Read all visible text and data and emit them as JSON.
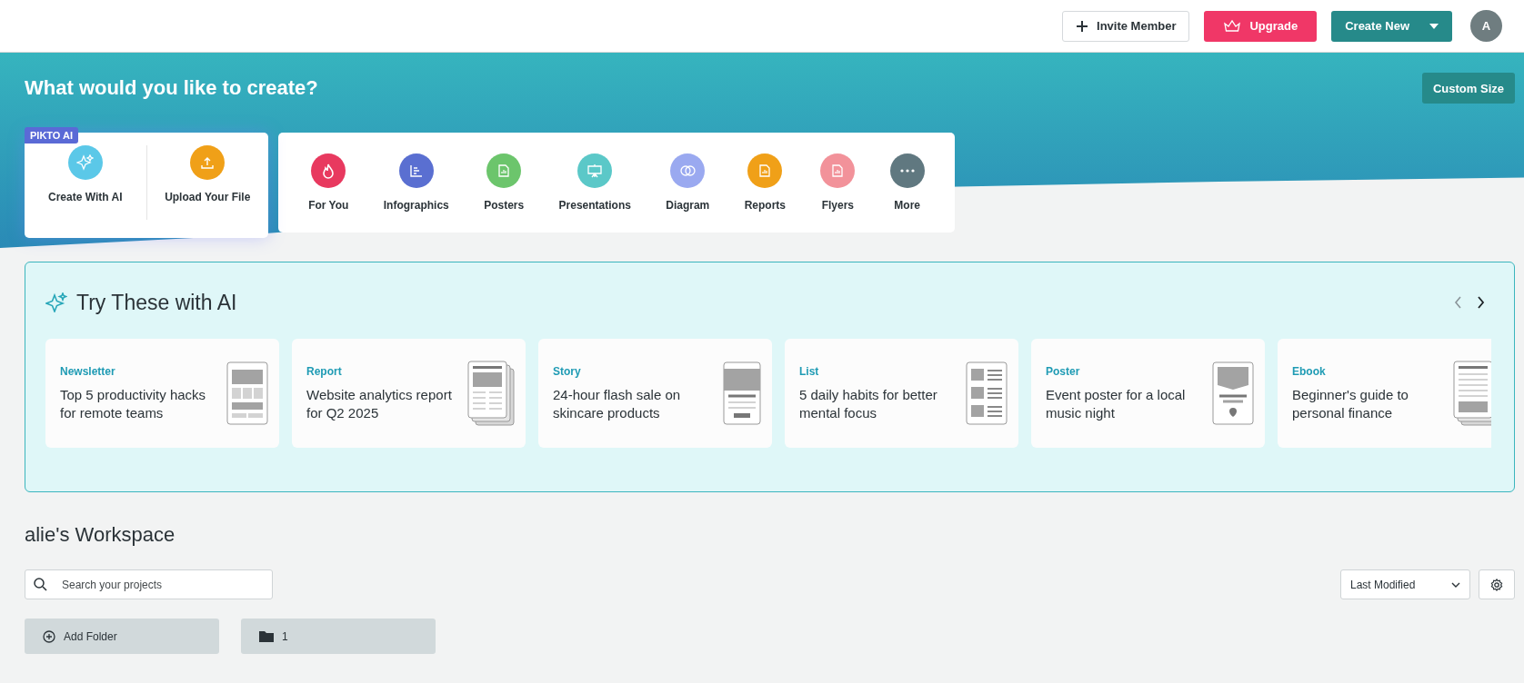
{
  "topbar": {
    "buttons": [
      {
        "kind": "invite",
        "label": "Invite Member"
      },
      {
        "kind": "upgrade",
        "label": "Upgrade"
      },
      {
        "kind": "create",
        "label": "Create New"
      }
    ],
    "avatar": "A"
  },
  "banner": {
    "title": "What would you like to create?",
    "custom_size": "Custom Size"
  },
  "quick_create": {
    "badge": "PIKTO AI",
    "items": [
      {
        "label": "Create With AI",
        "kind": "sparkle",
        "color": "#5bc8e8"
      },
      {
        "label": "Upload Your File",
        "kind": "upload",
        "color": "#f0a018"
      }
    ]
  },
  "categories": [
    {
      "label": "For You",
      "kind": "flame",
      "color": "#e8395f"
    },
    {
      "label": "Infographics",
      "kind": "chart",
      "color": "#5a6fd1"
    },
    {
      "label": "Posters",
      "kind": "doc",
      "color": "#6cc56c"
    },
    {
      "label": "Presentations",
      "kind": "board",
      "color": "#5bc8c8"
    },
    {
      "label": "Diagram",
      "kind": "venn",
      "color": "#9aa9f0"
    },
    {
      "label": "Reports",
      "kind": "doc",
      "color": "#f0a018"
    },
    {
      "label": "Flyers",
      "kind": "doc",
      "color": "#f2929a"
    },
    {
      "label": "More",
      "kind": "dots",
      "color": "#607880"
    }
  ],
  "ai_panel": {
    "title": "Try These with AI",
    "cards": [
      {
        "kind": "newsletter",
        "tag": "Newsletter",
        "text": "Top 5 productivity hacks for remote teams"
      },
      {
        "kind": "report",
        "tag": "Report",
        "text": "Website analytics report for Q2 2025"
      },
      {
        "kind": "story",
        "tag": "Story",
        "text": "24-hour flash sale on skincare products"
      },
      {
        "kind": "list",
        "tag": "List",
        "text": "5 daily habits for better mental focus"
      },
      {
        "kind": "poster",
        "tag": "Poster",
        "text": "Event poster for a local music night"
      },
      {
        "kind": "ebook",
        "tag": "Ebook",
        "text": "Beginner's guide to personal finance"
      }
    ]
  },
  "workspace": {
    "title": "alie's Workspace",
    "search": {
      "placeholder": "Search your projects"
    },
    "sort": "Last Modified",
    "folders": [
      {
        "kind": "add",
        "label": "Add Folder"
      },
      {
        "kind": "folder",
        "label": "1"
      }
    ]
  }
}
